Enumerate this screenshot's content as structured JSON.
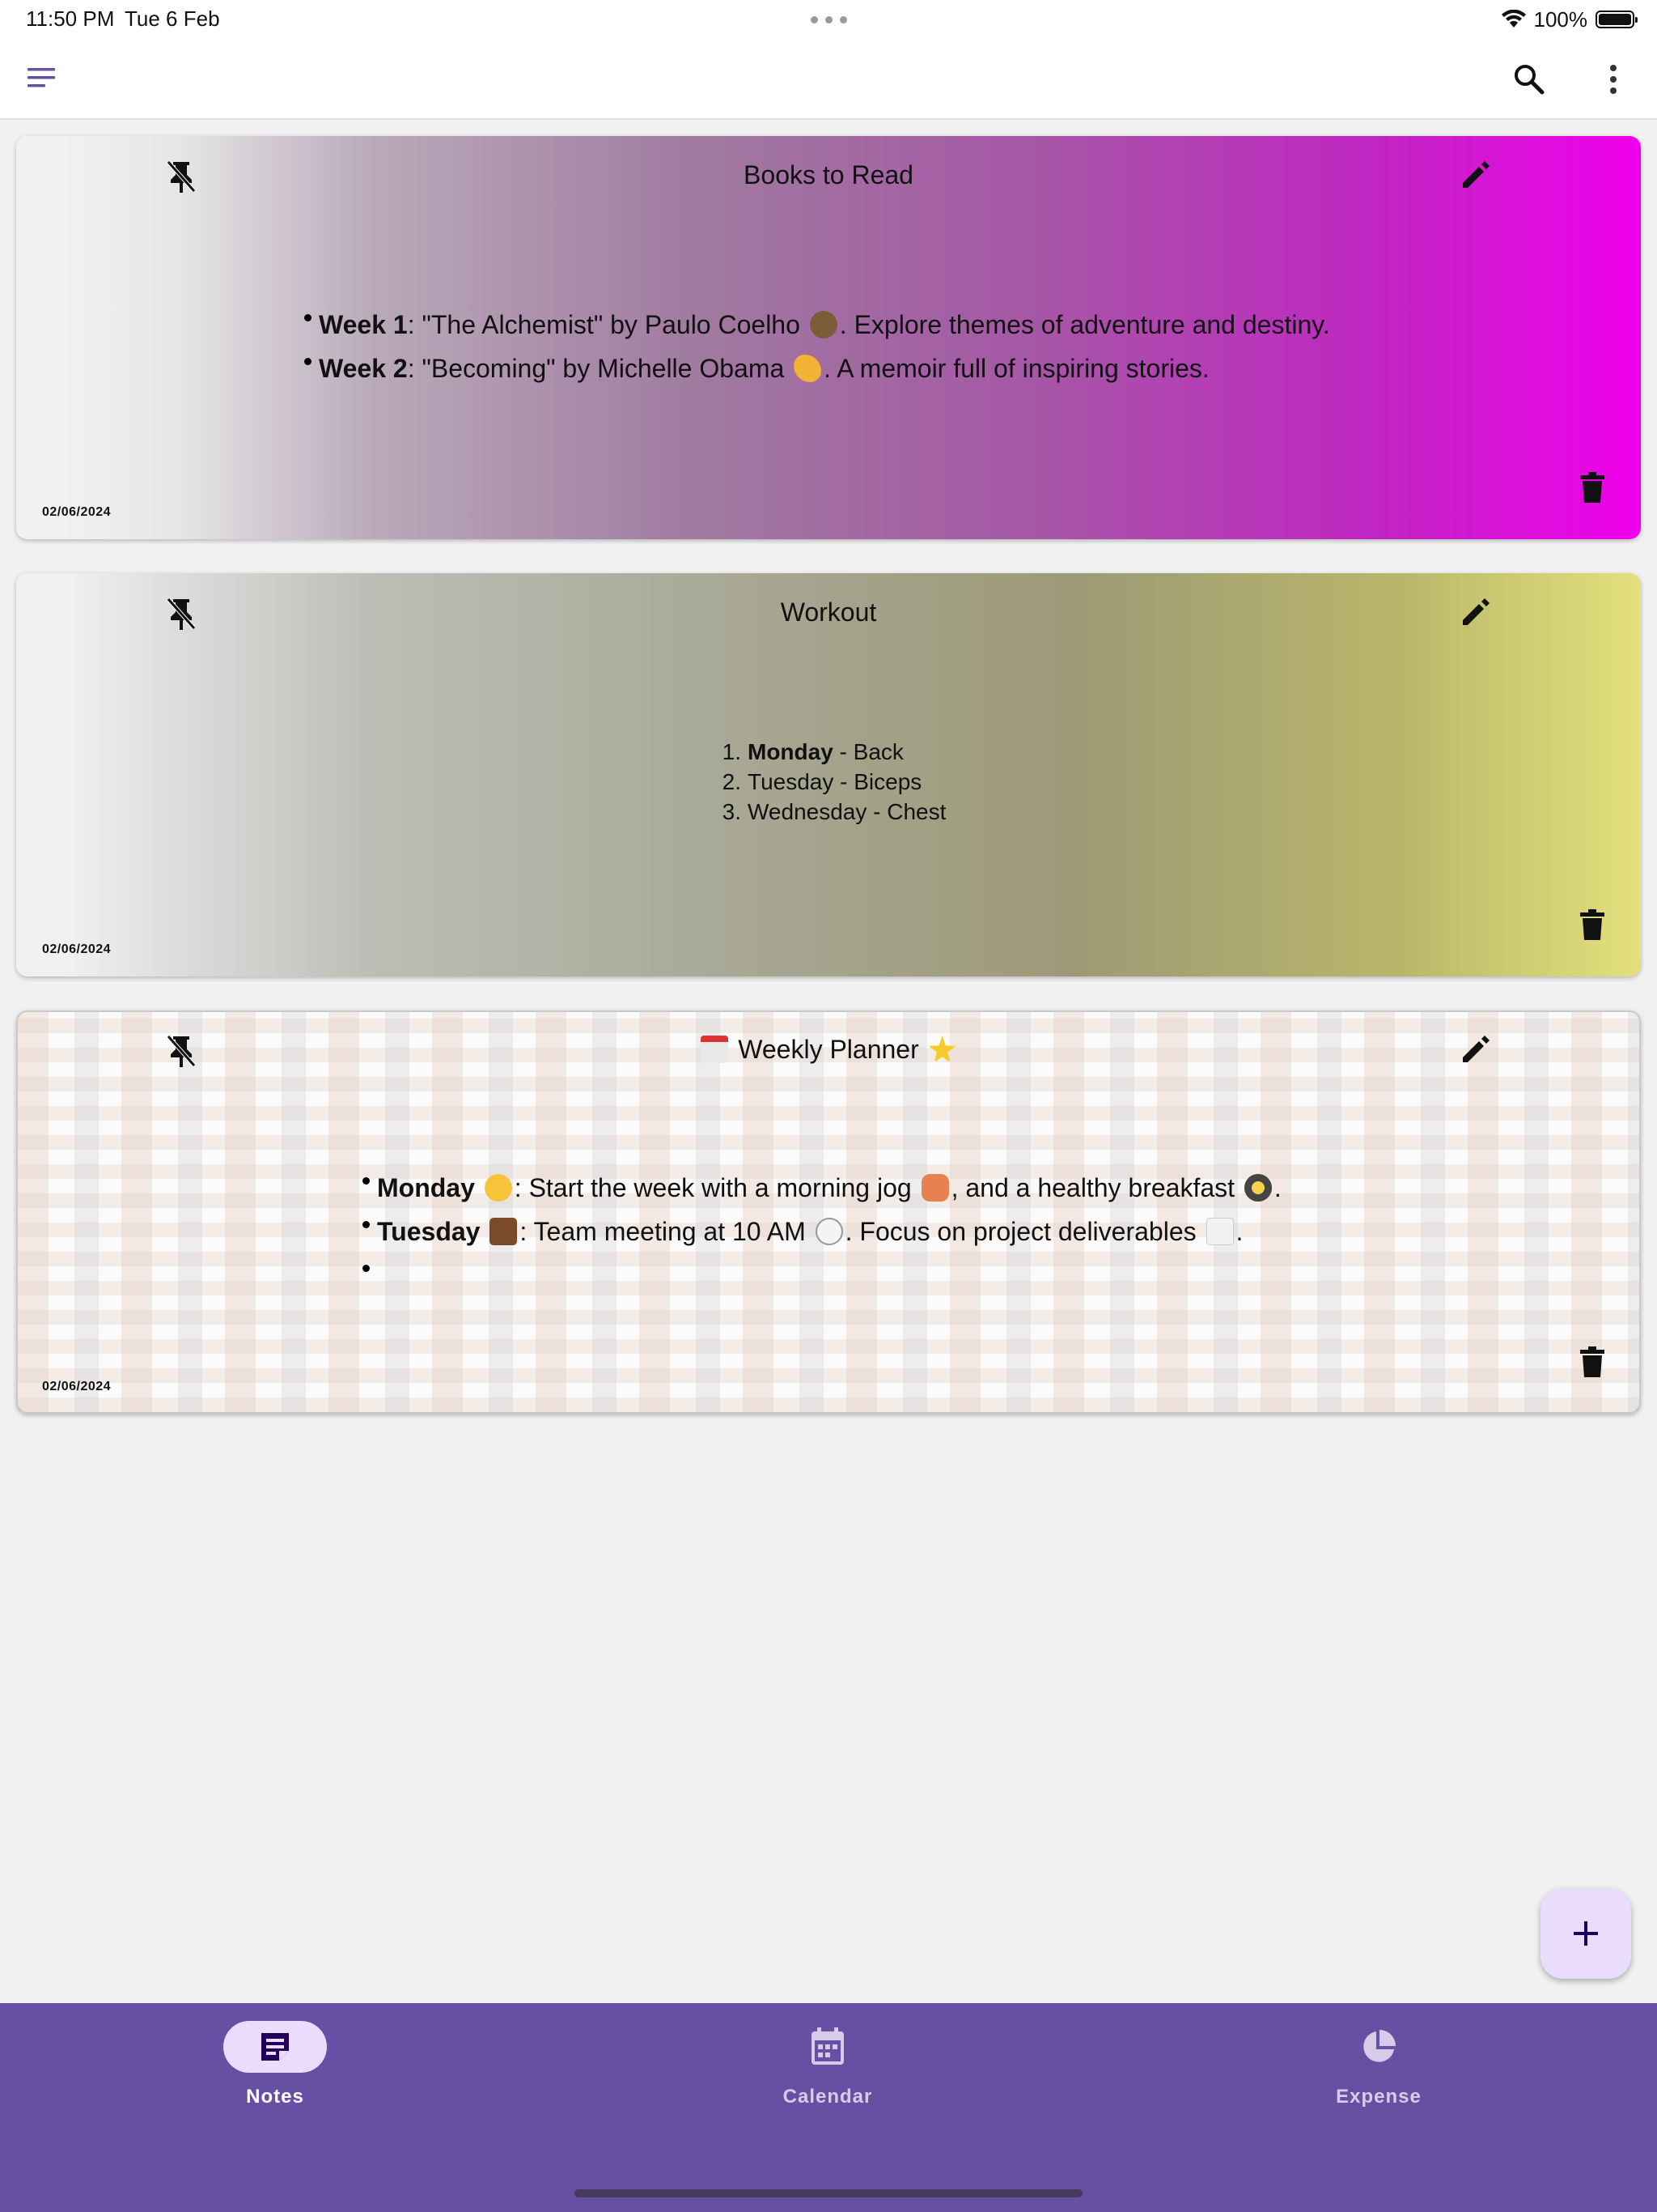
{
  "status_bar": {
    "time": "11:50 PM",
    "date": "Tue 6 Feb",
    "battery": "100%"
  },
  "app_bar": {
    "menu_icon": "menu-icon",
    "search_icon": "search-icon",
    "more_icon": "more-vert-icon"
  },
  "notes": [
    {
      "title": "Books to Read",
      "date": "02/06/2024",
      "background": [
        "#f1f1f1",
        "#a07aa0",
        "#f000ec"
      ],
      "items": [
        {
          "bold": "Week 1",
          "text_before_emoji": ": \"The Alchemist\" by Paulo Coelho ",
          "emoji": "🧙",
          "text_after_emoji": ". Explore themes of adventure and destiny."
        },
        {
          "bold": "Week 2",
          "text_before_emoji": ": \"Becoming\" by Michelle Obama ",
          "emoji": "💪",
          "text_after_emoji": ". A memoir full of inspiring stories."
        }
      ]
    },
    {
      "title": "Workout",
      "date": "02/06/2024",
      "background": [
        "#f1f1f1",
        "#9c9a76",
        "#e3e07c"
      ],
      "items": [
        {
          "num": "1.",
          "bold": "Monday",
          "text": " - Back"
        },
        {
          "num": "2.",
          "bold": "",
          "text": "Tuesday - Biceps"
        },
        {
          "num": "3.",
          "bold": "",
          "text": "Wednesday - Chest"
        }
      ]
    },
    {
      "title_emoji_left": "📅",
      "title": "Weekly Planner",
      "title_emoji_right": "🌟",
      "date": "02/06/2024",
      "background": [
        "#fbfbfb",
        "#e6d2c8"
      ],
      "items": [
        {
          "bold": "Monday",
          "emoji1": "🌞",
          "text1": ": Start the week with a morning jog ",
          "emoji2": "🏃",
          "text2": ", and a healthy breakfast ",
          "emoji3": "🍳",
          "text3": "."
        },
        {
          "bold": "Tuesday",
          "emoji1": "💼",
          "text1": ": Team meeting at 10 AM ",
          "emoji2": "🕙",
          "text2": ". Focus on project deliverables ",
          "emoji3": "📈",
          "text3": "."
        },
        {
          "bold": "",
          "text1": ""
        }
      ]
    }
  ],
  "fab": {
    "icon": "plus-icon"
  },
  "bottom_nav": {
    "items": [
      {
        "label": "Notes",
        "icon": "note-icon",
        "selected": true
      },
      {
        "label": "Calendar",
        "icon": "calendar-icon",
        "selected": false
      },
      {
        "label": "Expense",
        "icon": "pie-chart-icon",
        "selected": false
      }
    ],
    "background": "#6750a4",
    "selected_pill": "#eadcfd"
  }
}
